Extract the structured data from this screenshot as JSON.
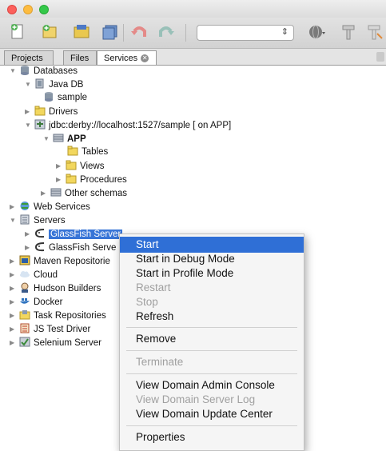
{
  "tabs": [
    {
      "label": "Projects"
    },
    {
      "label": "Files"
    },
    {
      "label": "Services"
    }
  ],
  "tree": {
    "databases": "Databases",
    "java_db": "Java DB",
    "sample": "sample",
    "drivers": "Drivers",
    "connection": "jdbc:derby://localhost:1527/sample [ on APP]",
    "app": "APP",
    "tables": "Tables",
    "views": "Views",
    "procedures": "Procedures",
    "other_schemas": "Other schemas",
    "web_services": "Web Services",
    "servers": "Servers",
    "glassfish_1": "GlassFish Server",
    "glassfish_2": "GlassFish Serve",
    "maven": "Maven Repositorie",
    "cloud": "Cloud",
    "hudson": "Hudson Builders",
    "docker": "Docker",
    "task_repos": "Task Repositories",
    "js_test": "JS Test Driver",
    "selenium": "Selenium Server"
  },
  "menu": {
    "start": "Start",
    "start_debug": "Start in Debug Mode",
    "start_profile": "Start in Profile Mode",
    "restart": "Restart",
    "stop": "Stop",
    "refresh": "Refresh",
    "remove": "Remove",
    "terminate": "Terminate",
    "admin_console": "View Domain Admin Console",
    "server_log": "View Domain Server Log",
    "update_center": "View Domain Update Center",
    "properties": "Properties"
  },
  "colors": {
    "selection": "#3875d7",
    "menu_highlight": "#2f6fd6"
  }
}
